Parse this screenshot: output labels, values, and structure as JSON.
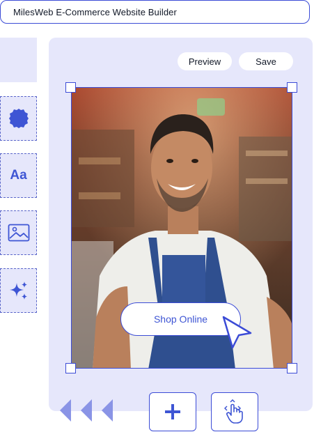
{
  "window": {
    "title": "MilesWeb E-Commerce Website Builder"
  },
  "toolbar": {
    "preview_label": "Preview",
    "save_label": "Save"
  },
  "tools": {
    "shape_icon": "circle-shape-icon",
    "text_label": "Aa",
    "image_icon": "image-icon",
    "magic_icon": "sparkles-icon"
  },
  "canvas": {
    "cta_label": "Shop Online",
    "photo": "smiling-shopkeeper-in-apron"
  },
  "bottom": {
    "nav_icon": "chevron-left-icon",
    "add_icon": "plus-icon",
    "touch_icon": "hand-pointer-icon"
  },
  "colors": {
    "accent": "#3e55d4",
    "panel": "#e6e7fb",
    "border": "#3b4bd6"
  }
}
